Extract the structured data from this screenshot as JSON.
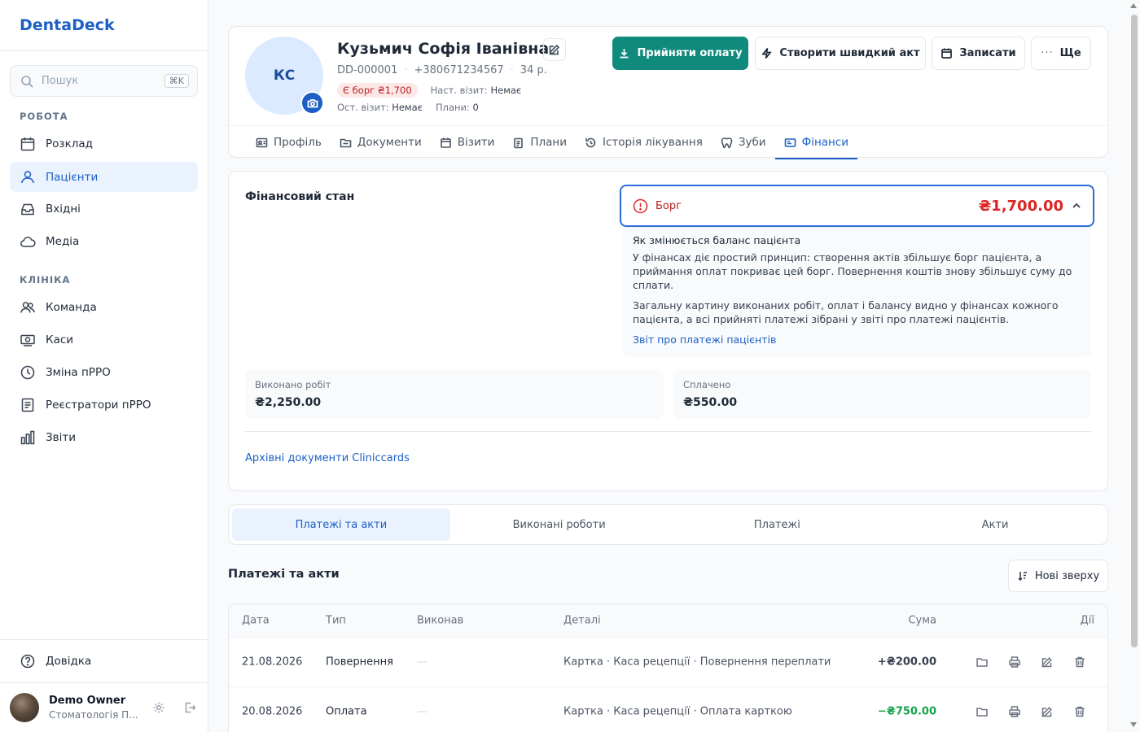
{
  "app": {
    "brand": "DentaDeck"
  },
  "sidebar": {
    "search": {
      "placeholder": "Пошук",
      "shortcut": "⌘K"
    },
    "sections": [
      {
        "title": "РОБОТА",
        "items": [
          {
            "label": "Розклад",
            "icon": "calendar-icon"
          },
          {
            "label": "Пацієнти",
            "icon": "users-icon",
            "active": true
          },
          {
            "label": "Вхідні",
            "icon": "inbox-icon"
          },
          {
            "label": "Медіа",
            "icon": "cloud-icon"
          }
        ]
      },
      {
        "title": "КЛІНІКА",
        "items": [
          {
            "label": "Команда",
            "icon": "team-icon"
          },
          {
            "label": "Каси",
            "icon": "cash-register-icon"
          },
          {
            "label": "Зміна пРРО",
            "icon": "clock-icon"
          },
          {
            "label": "Реєстратори пРРО",
            "icon": "receipt-icon"
          },
          {
            "label": "Звіти",
            "icon": "bar-chart-icon"
          }
        ]
      }
    ],
    "help": "Довідка",
    "user": {
      "name": "Demo Owner",
      "clinic": "Стоматологія П..."
    }
  },
  "patient": {
    "initials": "КС",
    "name": "Кузьмич Софія Іванівна",
    "id": "DD-000001",
    "phone": "+380671234567",
    "age": "34 р.",
    "debt_badge": "Є борг ₴1,700",
    "next_visit_label": "Наст. візит:",
    "next_visit_value": "Немає",
    "last_visit_label": "Ост. візит:",
    "last_visit_value": "Немає",
    "plans_label": "Плани:",
    "plans_value": "0"
  },
  "actions": {
    "accept_payment": "Прийняти оплату",
    "quick_act": "Створити швидкий акт",
    "book": "Записати",
    "more": "Ще"
  },
  "tabs": [
    {
      "label": "Профіль",
      "icon": "profile-card-icon"
    },
    {
      "label": "Документи",
      "icon": "folder-icon"
    },
    {
      "label": "Візити",
      "icon": "calendar-icon"
    },
    {
      "label": "Плани",
      "icon": "clipboard-icon"
    },
    {
      "label": "Історія лікування",
      "icon": "history-icon"
    },
    {
      "label": "Зуби",
      "icon": "tooth-icon"
    },
    {
      "label": "Фінанси",
      "icon": "wallet-icon",
      "active": true
    }
  ],
  "finance": {
    "title": "Фінансовий стан",
    "debt_label": "Борг",
    "debt_amount": "₴1,700.00",
    "info_title": "Як змінюється баланс пацієнта",
    "info_p1": "У фінансах діє простий принцип: створення актів збільшує борг пацієнта, а приймання оплат покриває цей борг. Повернення коштів знову збільшує суму до сплати.",
    "info_p2": "Загальну картину виконаних робіт, оплат і балансу видно у фінансах кожного пацієнта, а всі прийняті платежі зібрані у звіті про платежі пацієнтів.",
    "info_link": "Звіт про платежі пацієнтів",
    "work_done_label": "Виконано робіт",
    "work_done_value": "₴2,250.00",
    "paid_label": "Сплачено",
    "paid_value": "₴550.00",
    "archive_link": "Архівні документи Cliniccards"
  },
  "segments": [
    {
      "label": "Платежі та акти",
      "active": true
    },
    {
      "label": "Виконані роботи"
    },
    {
      "label": "Платежі"
    },
    {
      "label": "Акти"
    }
  ],
  "ledger": {
    "title": "Платежі та акти",
    "sort_label": "Нові зверху",
    "columns": {
      "date": "Дата",
      "type": "Тип",
      "performer": "Виконав",
      "details": "Деталі",
      "amount": "Сума",
      "actions": "Дії"
    },
    "rows": [
      {
        "date": "21.08.2026",
        "type": "Повернення",
        "performer": "—",
        "details": "Картка · Каса рецепції · Повернення переплати",
        "amount": "+₴200.00",
        "sign": "pos"
      },
      {
        "date": "20.08.2026",
        "type": "Оплата",
        "performer": "—",
        "details": "Картка · Каса рецепції · Оплата карткою",
        "amount": "−₴750.00",
        "sign": "neg"
      }
    ]
  },
  "colors": {
    "brand": "#1d5fc4",
    "primary_action": "#0f8a7c",
    "debt": "#dc2626",
    "payment": "#16a34a"
  }
}
